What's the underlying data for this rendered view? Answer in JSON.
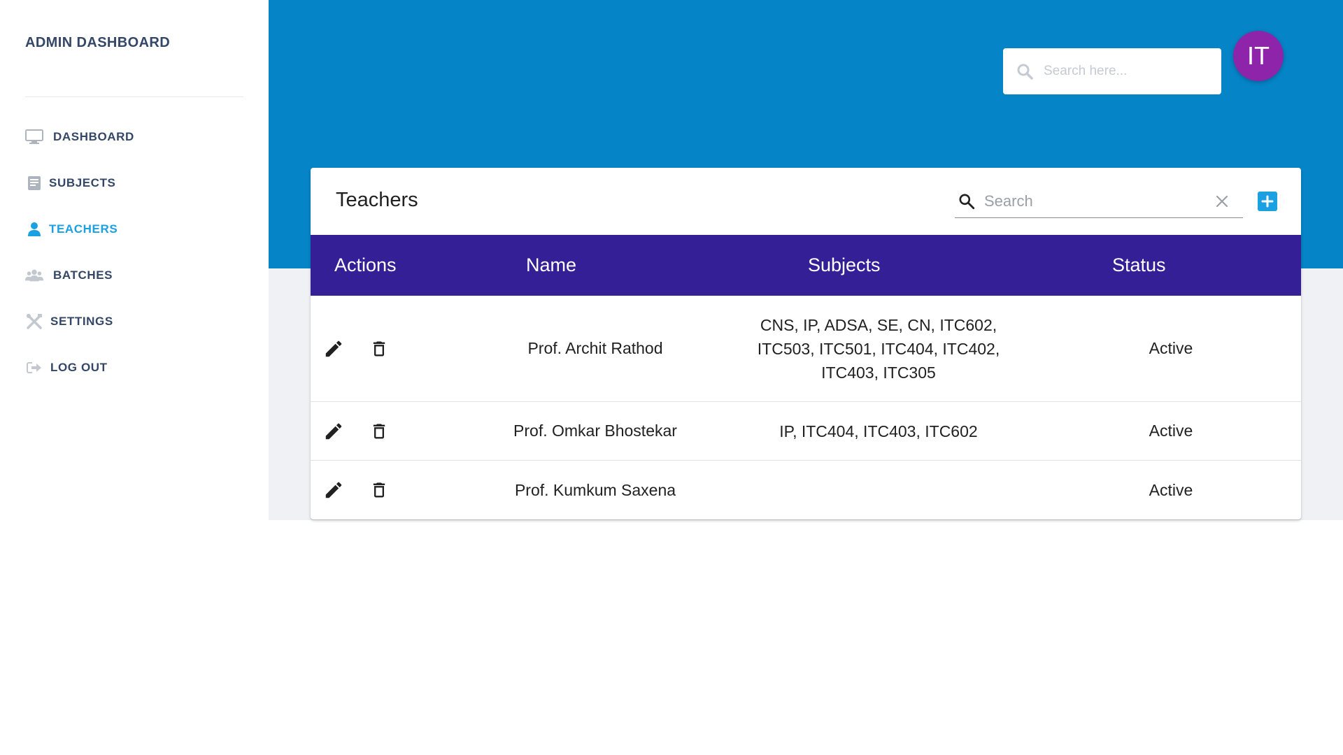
{
  "sidebar": {
    "brand": "ADMIN DASHBOARD",
    "items": [
      {
        "label": "DASHBOARD",
        "icon": "monitor-icon",
        "active": false
      },
      {
        "label": "SUBJECTS",
        "icon": "book-icon",
        "active": false
      },
      {
        "label": "TEACHERS",
        "icon": "person-icon",
        "active": true
      },
      {
        "label": "BATCHES",
        "icon": "users-group-icon",
        "active": false
      },
      {
        "label": "SETTINGS",
        "icon": "tools-icon",
        "active": false
      },
      {
        "label": "LOG OUT",
        "icon": "logout-icon",
        "active": false
      }
    ]
  },
  "header": {
    "search_placeholder": "Search here...",
    "avatar_initials": "IT"
  },
  "card": {
    "title": "Teachers",
    "search_placeholder": "Search"
  },
  "table": {
    "columns": [
      "Actions",
      "Name",
      "Subjects",
      "Status"
    ],
    "rows": [
      {
        "name": "Prof. Archit Rathod",
        "subjects_lines": [
          "CNS, IP, ADSA, SE, CN, ITC602,",
          "ITC503, ITC501, ITC404, ITC402,",
          "ITC403, ITC305"
        ],
        "status": "Active"
      },
      {
        "name": "Prof. Omkar Bhostekar",
        "subjects_lines": [
          "IP, ITC404, ITC403, ITC602"
        ],
        "status": "Active"
      },
      {
        "name": "Prof. Kumkum Saxena",
        "subjects_lines": [],
        "status": "Active"
      }
    ]
  },
  "colors": {
    "header_blue": "#0584c7",
    "table_header": "#351f96",
    "accent": "#1ba0e2",
    "avatar": "#8e24aa",
    "sidebar_text": "#344767"
  }
}
